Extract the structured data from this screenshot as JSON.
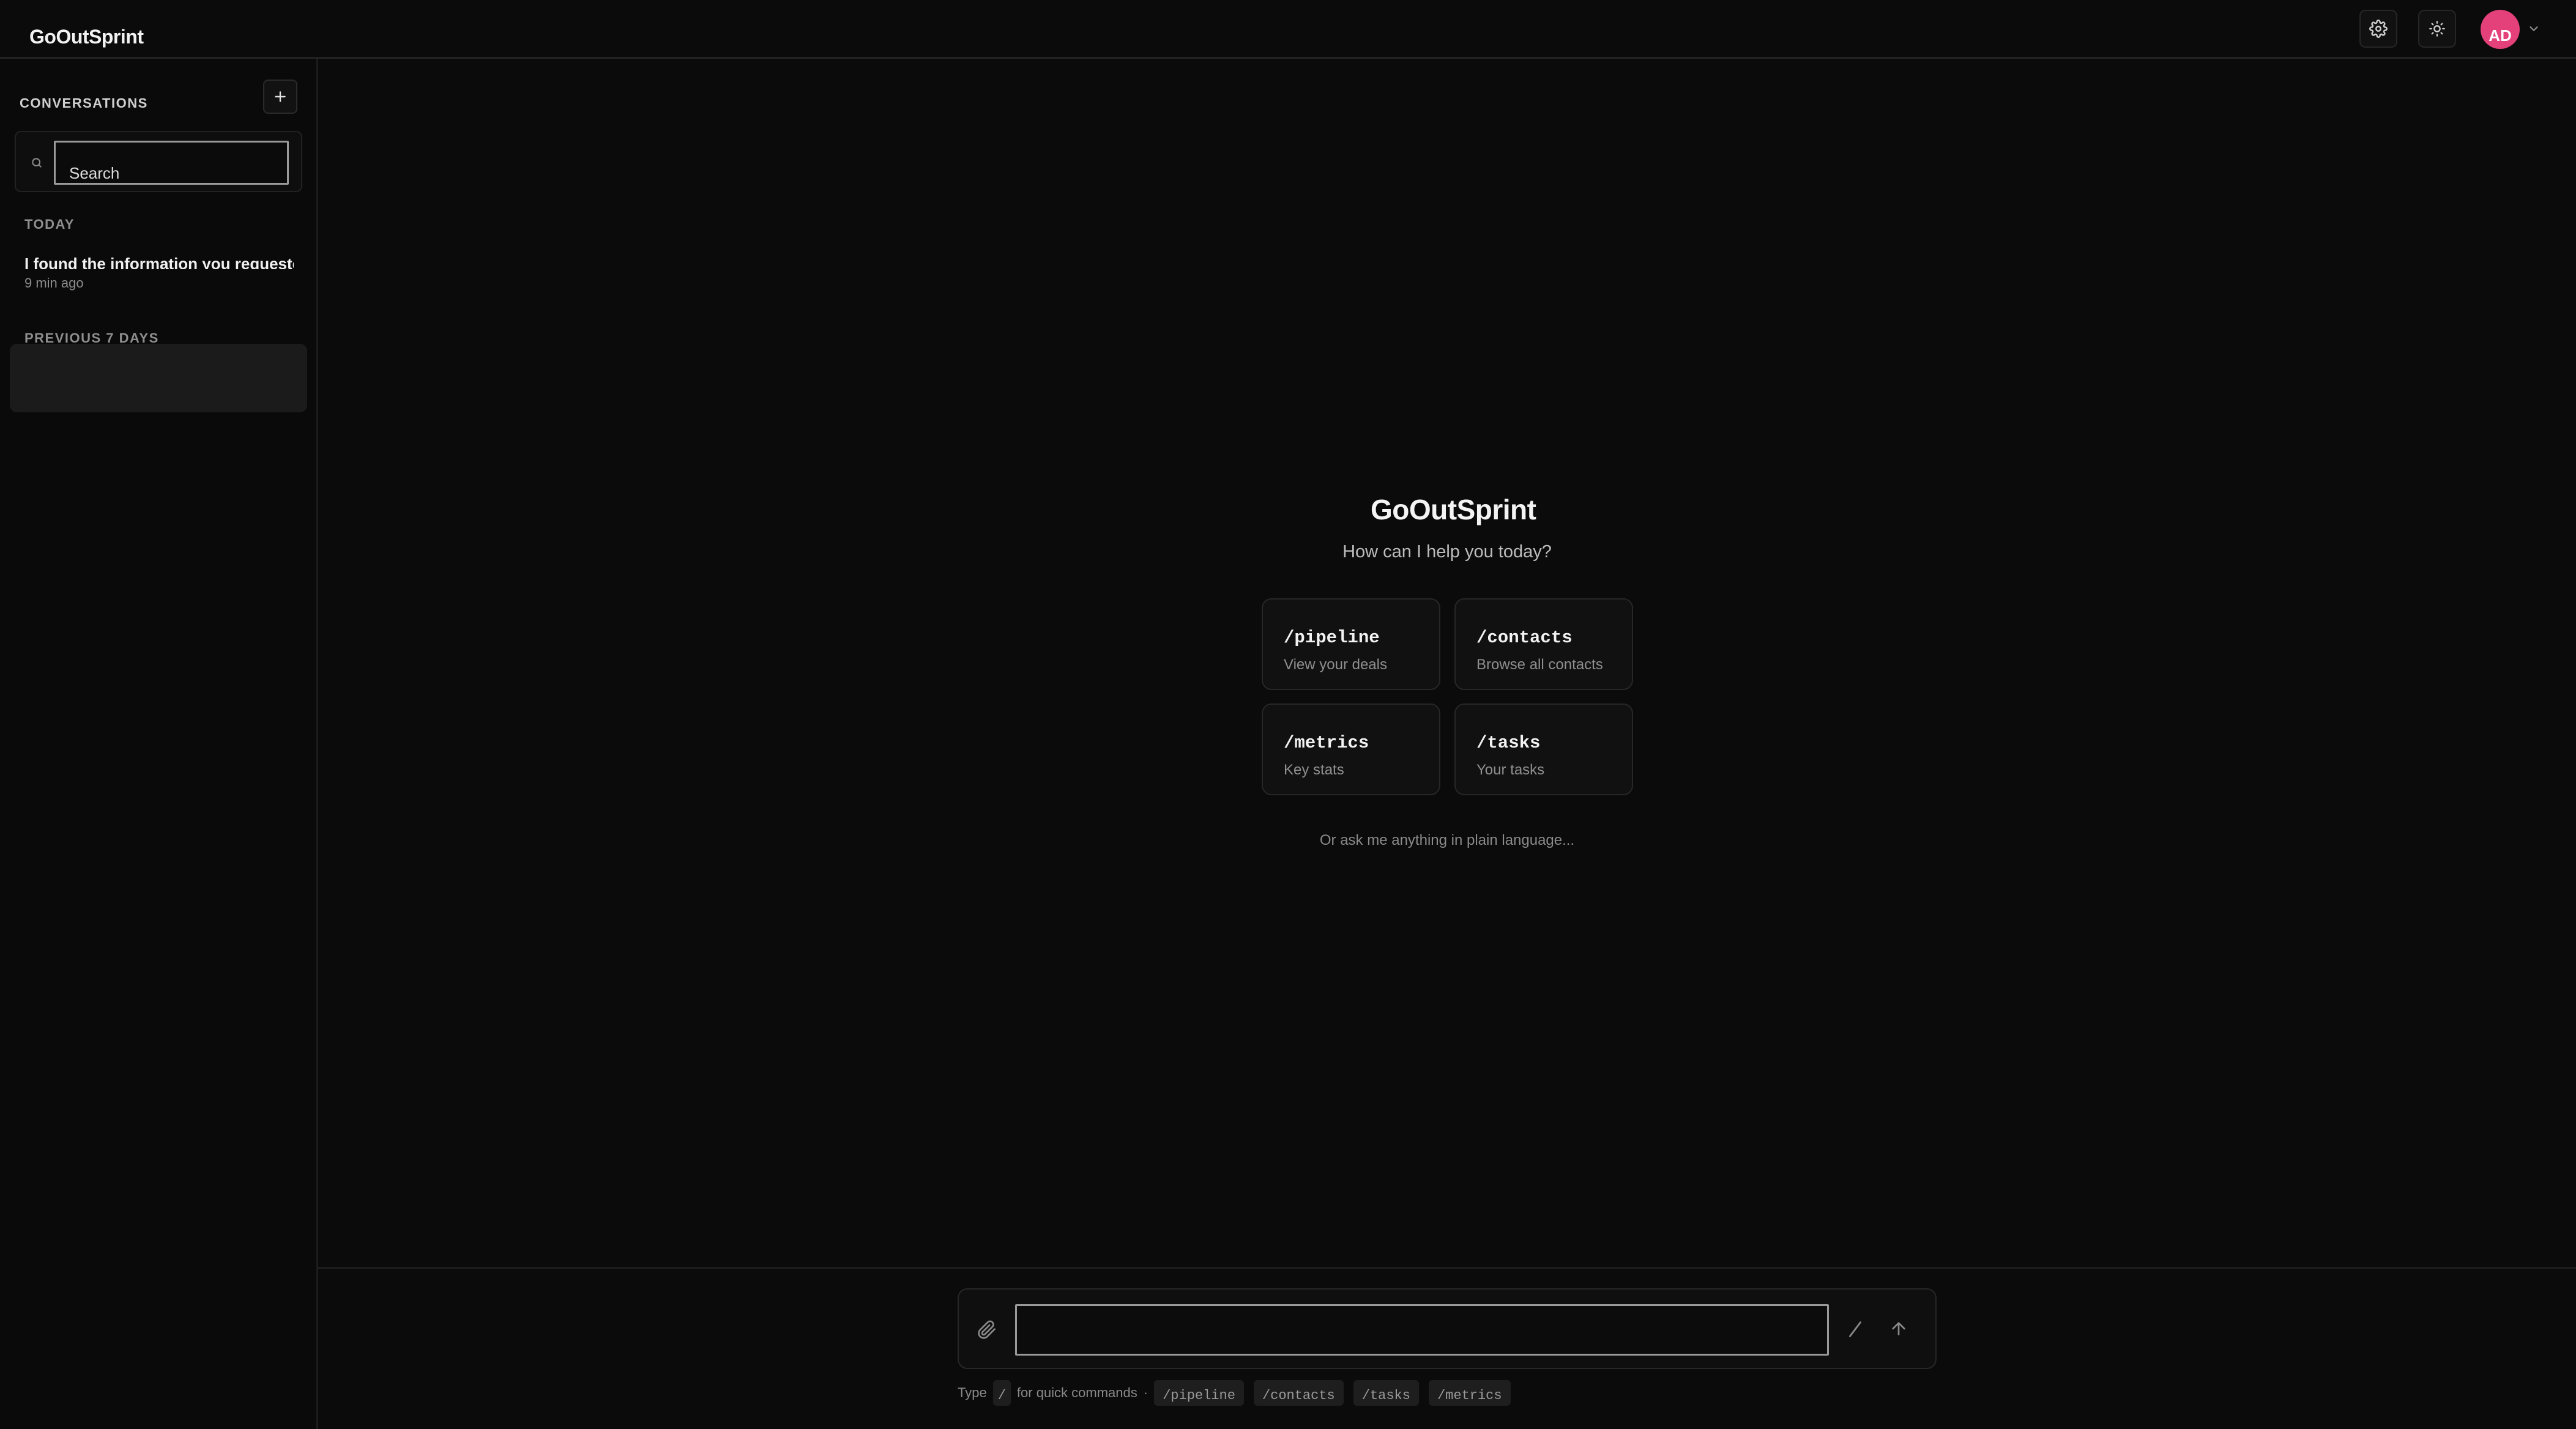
{
  "app": {
    "title": "GoOutSprint"
  },
  "header": {
    "settings_icon": "gear-icon",
    "theme_icon": "sun-icon",
    "avatar_initials": "AD"
  },
  "sidebar": {
    "title": "CONVERSATIONS",
    "new_button_icon": "plus-icon",
    "search": {
      "placeholder": "Search",
      "value": ""
    },
    "groups": [
      {
        "label": "TODAY",
        "items": [
          {
            "title": "I found the information you requested",
            "time": "9 min ago"
          }
        ]
      },
      {
        "label": "PREVIOUS 7 DAYS",
        "items": []
      }
    ]
  },
  "main": {
    "title": "GoOutSprint",
    "subtitle": "How can I help you today?",
    "cards": [
      {
        "command": "/pipeline",
        "description": "View your deals"
      },
      {
        "command": "/contacts",
        "description": "Browse all contacts"
      },
      {
        "command": "/metrics",
        "description": "Key stats"
      },
      {
        "command": "/tasks",
        "description": "Your tasks"
      }
    ],
    "hint": "Or ask me anything in plain language..."
  },
  "composer": {
    "value": "",
    "attach_icon": "paperclip-icon",
    "slash_icon": "slash-icon",
    "send_icon": "arrow-up-icon",
    "quick": {
      "prefix": "Type",
      "key": "/",
      "suffix": "for quick commands",
      "separator": "·",
      "commands": [
        "/pipeline",
        "/contacts",
        "/tasks",
        "/metrics"
      ]
    }
  },
  "colors": {
    "background": "#0b0b0b",
    "sidebar": "#0a0a0a",
    "border": "#232323",
    "avatar": "#e4407a",
    "card": "#111111"
  }
}
